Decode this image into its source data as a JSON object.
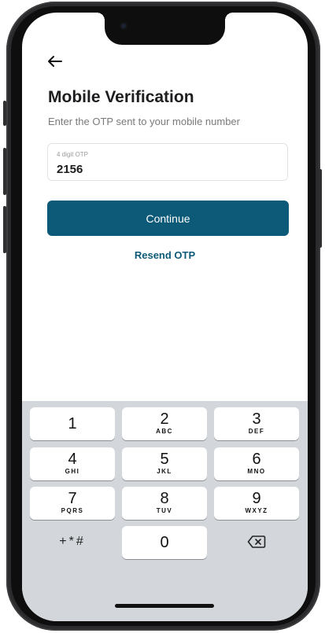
{
  "header": {
    "back_icon": "arrow-left-icon",
    "title": "Mobile Verification",
    "subtitle": "Enter the OTP sent to your mobile number"
  },
  "otp_field": {
    "label": "4 digit OTP",
    "value": "2156"
  },
  "actions": {
    "continue_label": "Continue",
    "resend_label": "Resend OTP"
  },
  "keyboard": {
    "keys": [
      {
        "num": "1",
        "letters": ""
      },
      {
        "num": "2",
        "letters": "ABC"
      },
      {
        "num": "3",
        "letters": "DEF"
      },
      {
        "num": "4",
        "letters": "GHI"
      },
      {
        "num": "5",
        "letters": "JKL"
      },
      {
        "num": "6",
        "letters": "MNO"
      },
      {
        "num": "7",
        "letters": "PQRS"
      },
      {
        "num": "8",
        "letters": "TUV"
      },
      {
        "num": "9",
        "letters": "WXYZ"
      },
      {
        "num": "0",
        "letters": ""
      }
    ],
    "symbols_label": "+*#",
    "delete_icon": "backspace-icon"
  },
  "colors": {
    "accent": "#0c5a77",
    "keyboard_bg": "#d3d6db"
  }
}
